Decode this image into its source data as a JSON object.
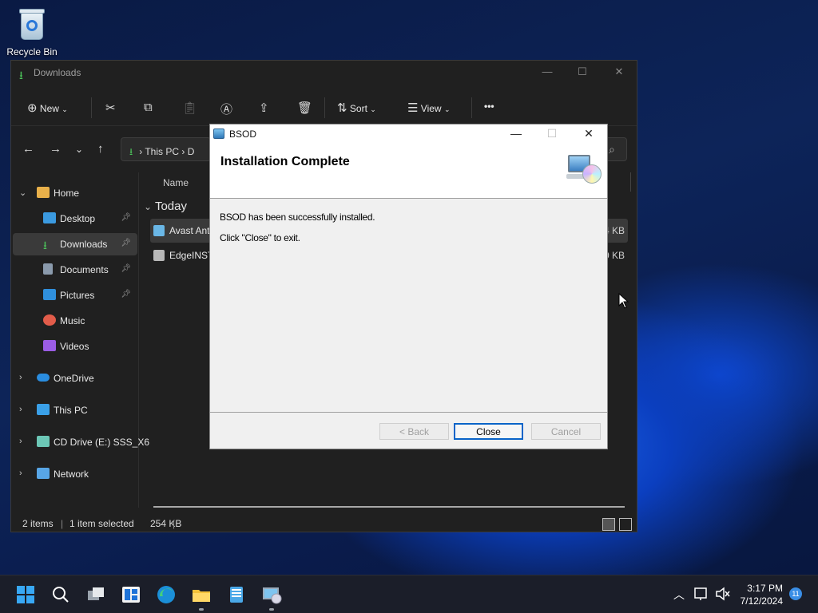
{
  "desktop": {
    "recycle_bin_label": "Recycle Bin"
  },
  "explorer": {
    "title": "Downloads",
    "toolbar": {
      "new_label": "New",
      "sort_label": "Sort",
      "view_label": "View",
      "more_label": "•••"
    },
    "address": {
      "segment1": "This PC",
      "segment2": "D"
    },
    "nav_items": [
      {
        "label": "Home",
        "icon": "home-icon",
        "color": "#e8b04a"
      },
      {
        "label": "Desktop",
        "icon": "desktop-icon",
        "color": "#3b9ae0"
      },
      {
        "label": "Downloads",
        "icon": "downloads-icon",
        "color": "#4cc35a"
      },
      {
        "label": "Documents",
        "icon": "documents-icon",
        "color": "#8a9aac"
      },
      {
        "label": "Pictures",
        "icon": "pictures-icon",
        "color": "#2f8fdc"
      },
      {
        "label": "Music",
        "icon": "music-icon",
        "color": "#e25c4a"
      },
      {
        "label": "Videos",
        "icon": "videos-icon",
        "color": "#9b5de5"
      },
      {
        "label": "OneDrive",
        "icon": "onedrive-icon",
        "color": "#2a8de0"
      },
      {
        "label": "This PC",
        "icon": "thispc-icon",
        "color": "#3aa0e8"
      },
      {
        "label": "CD Drive (E:) SSS_X6",
        "icon": "cd-drive-icon",
        "color": "#6cc7b6"
      },
      {
        "label": "Network",
        "icon": "network-icon",
        "color": "#58a6e6"
      }
    ],
    "column_name": "Name",
    "group_label": "Today",
    "files": [
      {
        "name": "Avast Ant",
        "size": "4 KB"
      },
      {
        "name": "EdgeINST",
        "size": "0 KB"
      }
    ],
    "status": {
      "count": "2 items",
      "selection": "1 item selected",
      "size": "254 KB",
      "separator": "|"
    }
  },
  "dialog": {
    "title": "BSOD",
    "heading": "Installation Complete",
    "line1": "BSOD has been successfully installed.",
    "line2": "Click \"Close\" to exit.",
    "back_label": "< Back",
    "close_label": "Close",
    "cancel_label": "Cancel"
  },
  "taskbar": {
    "time": "3:17 PM",
    "date": "7/12/2024",
    "notification_count": "11"
  }
}
